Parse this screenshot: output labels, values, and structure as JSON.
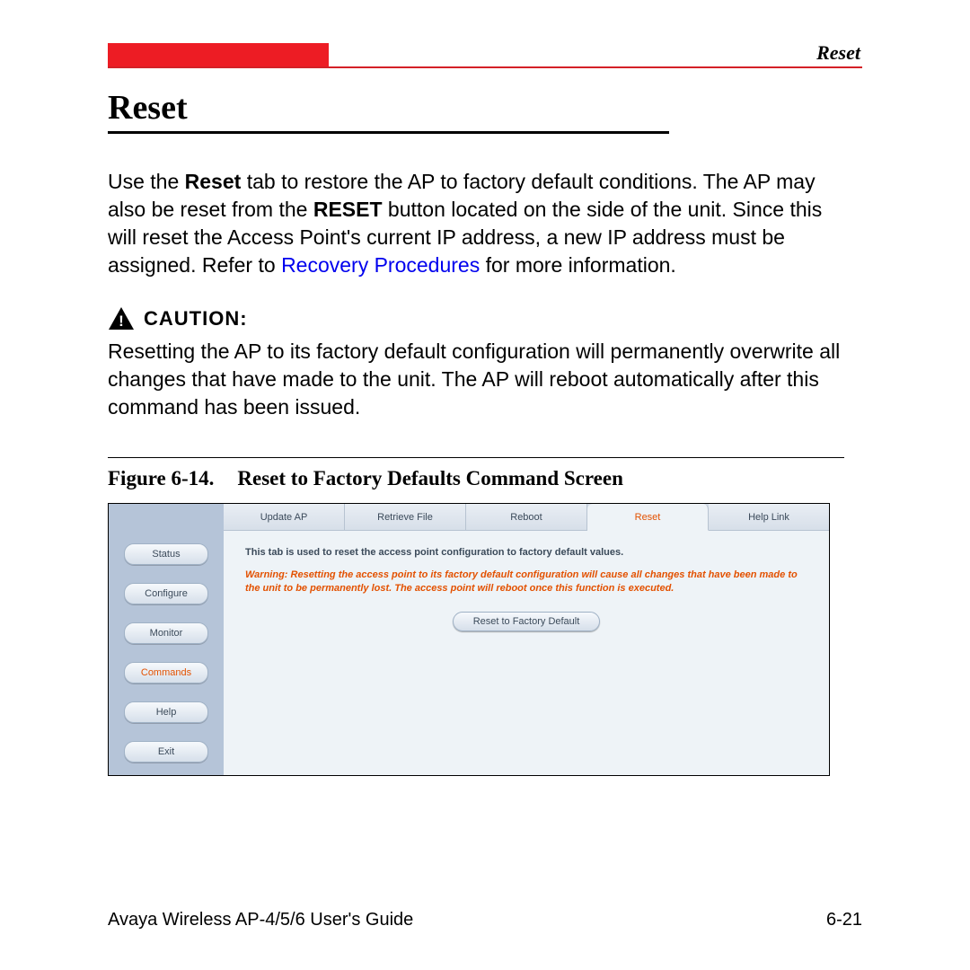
{
  "header": {
    "running_head": "Reset"
  },
  "title": "Reset",
  "paragraph1": {
    "pre": "Use the ",
    "bold1": "Reset",
    "mid1": " tab to restore the AP to factory default conditions. The AP may also be reset from the ",
    "bold2": "RESET",
    "mid2": " button located on the side of the unit. Since this will reset the Access Point's current IP address, a new IP address must be assigned. Refer to ",
    "link": "Recovery Procedures",
    "post": " for more information."
  },
  "caution": {
    "label": "CAUTION:",
    "text": "Resetting the AP to its factory default configuration will permanently overwrite all changes that have made to the unit. The AP will reboot automatically after this command has been issued."
  },
  "figure": {
    "number": "Figure 6-14.",
    "caption": "Reset to Factory Defaults Command Screen"
  },
  "screenshot": {
    "sidebar": {
      "items": [
        {
          "label": "Status",
          "active": false
        },
        {
          "label": "Configure",
          "active": false
        },
        {
          "label": "Monitor",
          "active": false
        },
        {
          "label": "Commands",
          "active": true
        },
        {
          "label": "Help",
          "active": false
        },
        {
          "label": "Exit",
          "active": false
        }
      ]
    },
    "tabs": [
      {
        "label": "Update AP",
        "active": false
      },
      {
        "label": "Retrieve File",
        "active": false
      },
      {
        "label": "Reboot",
        "active": false
      },
      {
        "label": "Reset",
        "active": true
      },
      {
        "label": "Help Link",
        "active": false
      }
    ],
    "desc": "This tab is used to reset the access point configuration to factory default values.",
    "warning": "Warning: Resetting the access point to its factory default configuration will cause all changes that have been made to the unit to be permanently lost. The access point will reboot once this function is executed.",
    "button": "Reset to Factory Default"
  },
  "footer": {
    "left": "Avaya Wireless AP-4/5/6 User's Guide",
    "right": "6-21"
  }
}
